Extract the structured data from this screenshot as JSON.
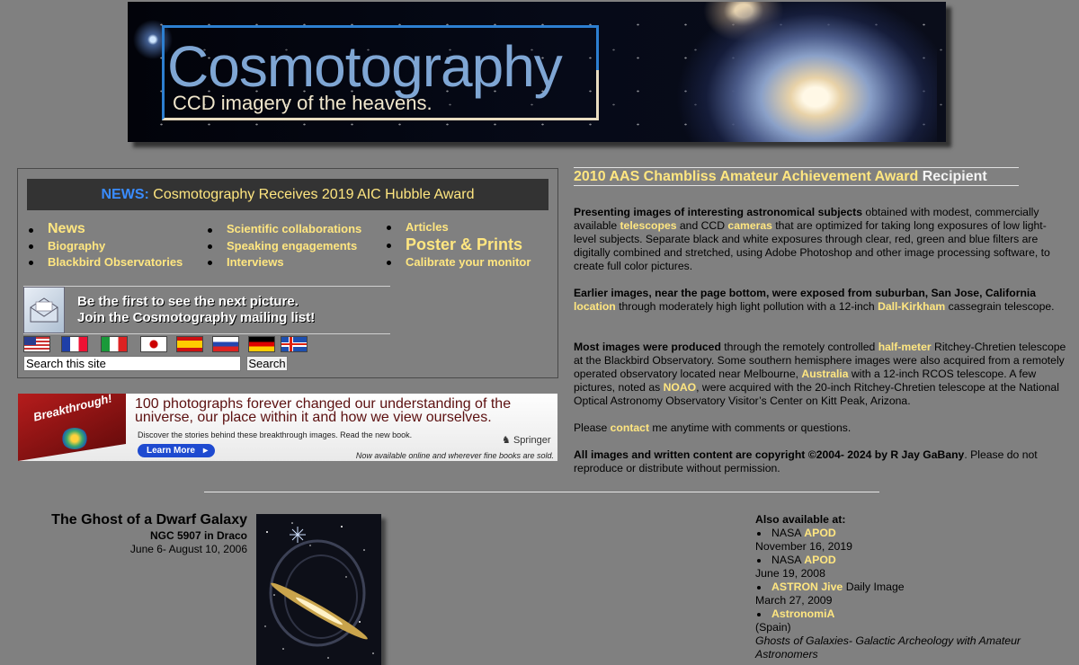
{
  "banner": {
    "title": "Cosmotography",
    "subtitle": "CCD imagery of the heavens."
  },
  "news": {
    "label": "NEWS:",
    "text": "Cosmotography Receives 2019 AIC Hubble Award"
  },
  "nav": {
    "col1": [
      "News",
      "Biography",
      "Blackbird Observatories"
    ],
    "col2": [
      "Scientific collaborations",
      "Speaking engagements",
      "Interviews"
    ],
    "col3": [
      "Articles",
      "Poster & Prints",
      "Calibrate your monitor"
    ]
  },
  "mailing": {
    "line1": "Be the first to see the next picture.",
    "line2": "Join the Cosmotography mailing list!",
    "icon": "envelope-icon"
  },
  "flags": [
    "us-flag-icon",
    "france-flag-icon",
    "italy-flag-icon",
    "japan-flag-icon",
    "spain-flag-icon",
    "russia-flag-icon",
    "germany-flag-icon",
    "iceland-flag-icon"
  ],
  "search": {
    "value": "Search this site",
    "button": "Search"
  },
  "ad": {
    "cover_title": "Breakthrough!",
    "line1": "100 photographs forever changed our understanding of the",
    "line2": "universe, our place within it and how we view ourselves.",
    "sub": "Discover the stories behind these breakthrough images.  Read the new book.",
    "learn_more": "Learn More",
    "publisher": "Springer",
    "availability": "Now available online and wherever fine books are sold."
  },
  "award": {
    "year": "2010",
    "name": "AAS Chambliss Amateur Achievement Award",
    "suffix": "Recipient"
  },
  "para1": {
    "b1": "Presenting images of interesting astronomical subjects",
    "t1": " obtained with modest, commercially available ",
    "l1": "telescopes",
    "t2": " and CCD ",
    "l2": "cameras",
    "t3": " that are optimized for taking long exposures of low light-level subjects. Separate black and white exposures through clear, red, green and blue filters are digitally combined and stretched, using Adobe Photoshop and other image processing software, to create full color pictures."
  },
  "para2": {
    "b1": "Earlier images, near the page bottom, were exposed from suburban, San Jose, California",
    "l1": "location",
    "t1": " through moderately high light pollution with a 12-inch ",
    "l2": "Dall-Kirkham",
    "t2": " cassegrain telescope."
  },
  "para3": {
    "b1": "Most images were produced",
    "t1": " through the remotely controlled ",
    "l1": "half-meter",
    "t2": " Ritchey-Chretien telescope at the Blackbird Observatory. Some southern hemisphere images were also acquired from a remotely operated observatory located near Melbourne, ",
    "l2": "Australia",
    "t3": " with a 12-inch RCOS telescope. A few pictures, noted as ",
    "l3": "NOAO",
    "t4": ", were acquired with the 20-inch Ritchey-Chretien telescope at the National Optical Astronomy Observatory Visitor’s Center on Kitt Peak, Arizona."
  },
  "para4": {
    "t1": "Please ",
    "l1": "contact",
    "t2": " me anytime with comments or questions."
  },
  "para5": {
    "b1": "All images and written content are copyright ©2004- 2024 by R Jay GaBany",
    "t1": ". Please do not reproduce or distribute without permission."
  },
  "featured": {
    "title": "The Ghost of a Dwarf Galaxy",
    "subtitle": "NGC 5907 in Draco",
    "date": "June 6- August 10, 2006"
  },
  "also": {
    "heading": "Also available at:",
    "items": [
      {
        "prefix": "NASA ",
        "link": "APOD",
        "suffix": "",
        "note": "November 16, 2019"
      },
      {
        "prefix": "NASA ",
        "link": "APOD",
        "suffix": "",
        "note": "June 19, 2008"
      },
      {
        "prefix": "",
        "link": "ASTRON Jive",
        "suffix": " Daily Image",
        "note": "March 27, 2009"
      },
      {
        "prefix": "",
        "link": "AstronomiA",
        "suffix": "",
        "note": "(Spain)"
      }
    ],
    "article": "Ghosts of Galaxies- Galactic Archeology with Amateur Astronomers"
  },
  "colors": {
    "background": "#808080",
    "link": "#ffe680",
    "news_label": "#3a8cff"
  }
}
